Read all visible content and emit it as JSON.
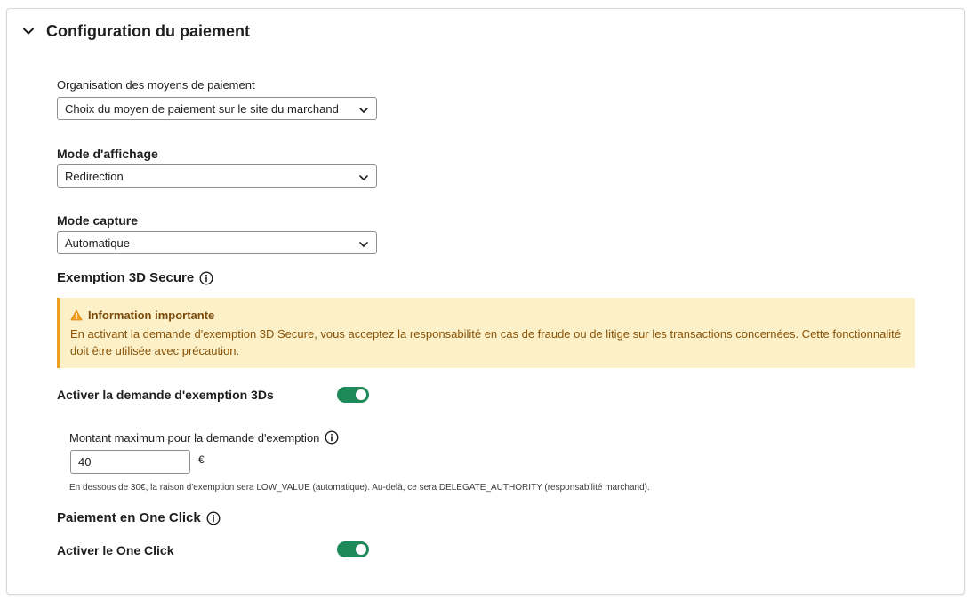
{
  "panel": {
    "title": "Configuration du paiement"
  },
  "organisation": {
    "label": "Organisation des moyens de paiement",
    "value": "Choix du moyen de paiement sur le site du marchand"
  },
  "display_mode": {
    "label": "Mode d'affichage",
    "value": "Redirection"
  },
  "capture_mode": {
    "label": "Mode capture",
    "value": "Automatique"
  },
  "exemption_section": {
    "title": "Exemption 3D Secure"
  },
  "notice": {
    "title": "Information importante",
    "text": "En activant la demande d'exemption 3D Secure, vous acceptez la responsabilité en cas de fraude ou de litige sur les transactions concernées. Cette fonctionnalité doit être utilisée avec précaution."
  },
  "exemption_toggle": {
    "label": "Activer la demande d'exemption 3Ds",
    "enabled": true
  },
  "max_amount": {
    "label": "Montant maximum pour la demande d'exemption",
    "value": "40",
    "currency": "€",
    "help": "En dessous de 30€, la raison d'exemption sera LOW_VALUE (automatique). Au-delà, ce sera DELEGATE_AUTHORITY (responsabilité marchand)."
  },
  "one_click_section": {
    "title": "Paiement en One Click"
  },
  "one_click_toggle": {
    "label": "Activer le One Click",
    "enabled": true
  },
  "colors": {
    "toggle_on": "#1e8a5a",
    "notice_bg": "#fcf0c9",
    "notice_border": "#f0a020",
    "notice_text": "#8a5306"
  },
  "icons": [
    "chevron-down-icon",
    "info-icon",
    "warning-icon"
  ]
}
